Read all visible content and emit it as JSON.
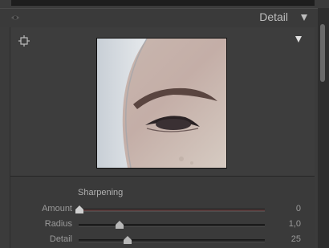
{
  "header": {
    "title": "Detail",
    "visibility_icon": "eye-icon",
    "collapse_icon": "triangle-down-icon"
  },
  "preview": {
    "target_icon": "crosshair-target-icon",
    "menu_icon": "triangle-down-icon",
    "image_alt": "zoomed eye preview"
  },
  "sharpening": {
    "section_label": "Sharpening",
    "sliders": [
      {
        "label": "Amount",
        "value": "0",
        "position": 0.0
      },
      {
        "label": "Radius",
        "value": "1,0",
        "position": 0.2
      },
      {
        "label": "Detail",
        "value": "25",
        "position": 0.25
      }
    ]
  },
  "colors": {
    "panel_bg": "#3b3b3b",
    "header_bg": "#3a3a3a",
    "text": "#a8a8a8",
    "amount_fill": "#5a3d3d"
  }
}
